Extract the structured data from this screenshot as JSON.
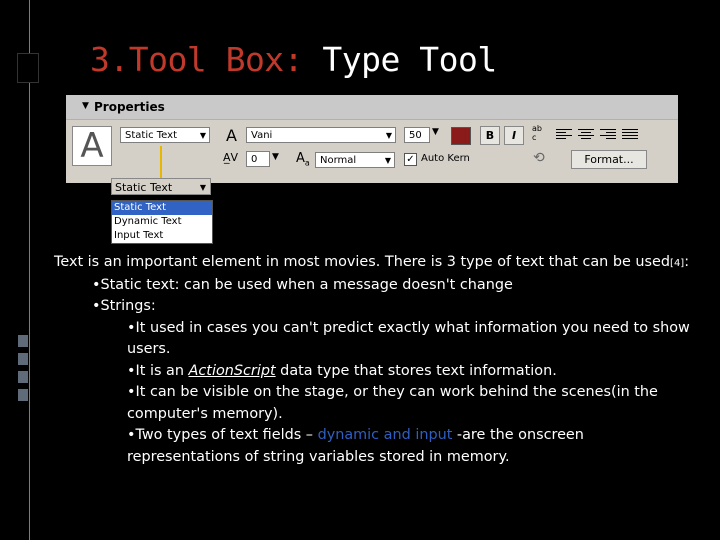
{
  "slide": {
    "title_accent": "3.Tool Box:",
    "title_rest": "Type Tool"
  },
  "properties_panel": {
    "header": "Properties",
    "text_type": "Static Text",
    "font": "Vani",
    "font_size": "50",
    "tracking": "0",
    "baseline": "Normal",
    "auto_kern_label": "Auto Kern",
    "auto_kern_checked": true,
    "bold_label": "B",
    "italic_label": "I",
    "format_button": "Format...",
    "color_swatch": "#8b1a1a"
  },
  "popup": {
    "selected": "Static Text",
    "options": [
      "Static Text",
      "Dynamic Text",
      "Input Text"
    ],
    "highlighted_index": 0
  },
  "body": {
    "intro": "Text is an important element in most movies. There is 3 type of text that can be used",
    "intro_ref": "[4]",
    "intro_end": ":",
    "b1": "•Static text:  can be used when a message doesn't change",
    "b2": "•Strings:",
    "b2_1": "•It used in cases  you can't predict exactly what information you need to show users.",
    "b2_2_pre": "•It is an ",
    "b2_2_link": "ActionScript",
    "b2_2_post": " data type that stores text information.",
    "b2_3": "•It can be visible on the stage, or they can work behind the scenes(in the computer's memory).",
    "b2_4_pre": "•Two types of text fields – ",
    "b2_4_blue": "dynamic and input",
    "b2_4_post": " -are the onscreen representations of string variables stored in memory."
  }
}
